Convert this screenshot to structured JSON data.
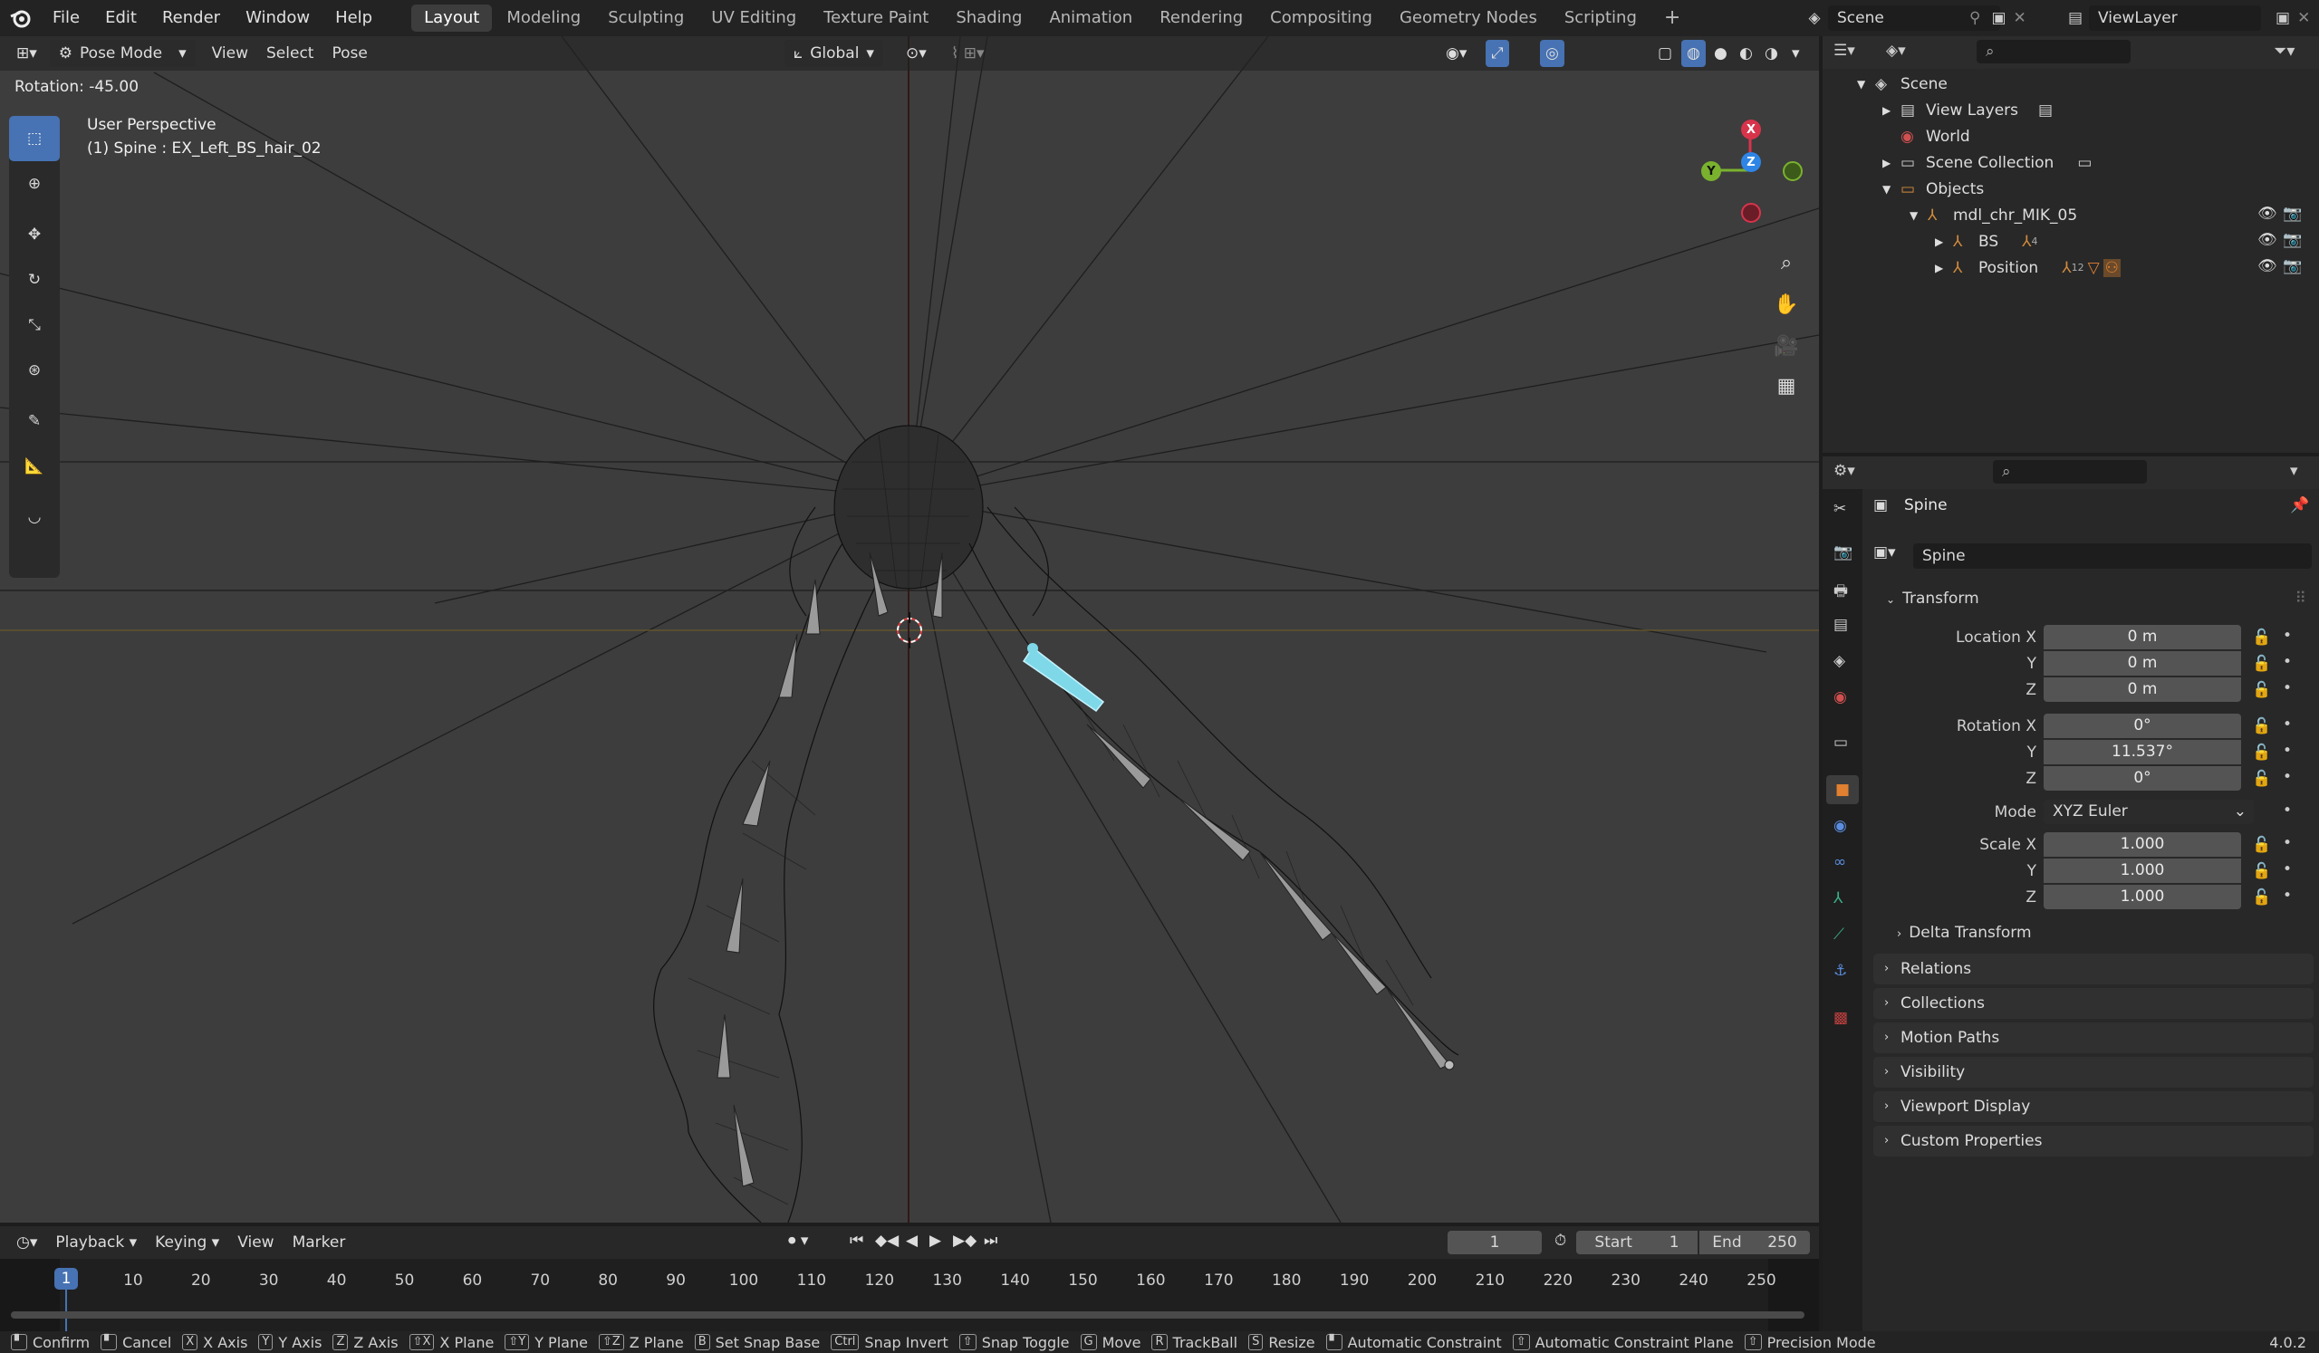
{
  "topbar": {
    "menus": [
      "File",
      "Edit",
      "Render",
      "Window",
      "Help"
    ],
    "workspaces": [
      "Layout",
      "Modeling",
      "Sculpting",
      "UV Editing",
      "Texture Paint",
      "Shading",
      "Animation",
      "Rendering",
      "Compositing",
      "Geometry Nodes",
      "Scripting"
    ],
    "active_workspace": "Layout",
    "add_tab": "+",
    "scene_label": "Scene",
    "viewlayer_label": "ViewLayer"
  },
  "viewport": {
    "mode_label": "Pose Mode",
    "menus": [
      "View",
      "Select",
      "Pose"
    ],
    "orientation": "Global",
    "operator_info": "Rotation: -45.00",
    "view_name": "User Perspective",
    "object_info": "(1) Spine : EX_Left_BS_hair_02",
    "gizmo": {
      "x": "X",
      "y": "Y",
      "z": "Z"
    }
  },
  "outliner": {
    "rows": [
      {
        "label": "Scene"
      },
      {
        "label": "View Layers"
      },
      {
        "label": "World"
      },
      {
        "label": "Scene Collection"
      },
      {
        "label": "Objects"
      },
      {
        "label": "mdl_chr_MIK_05"
      },
      {
        "label": "BS"
      },
      {
        "label": "Position"
      }
    ],
    "bs_count": "4",
    "position_count": "12"
  },
  "properties": {
    "header_name": "Spine",
    "object_name": "Spine",
    "transform_title": "Transform",
    "location_label": "Location X",
    "location": [
      "0 m",
      "0 m",
      "0 m"
    ],
    "rotation_label": "Rotation X",
    "rotation": [
      "0°",
      "11.537°",
      "0°"
    ],
    "mode_label": "Mode",
    "mode_value": "XYZ Euler",
    "scale_label": "Scale X",
    "scale": [
      "1.000",
      "1.000",
      "1.000"
    ],
    "axis_y": "Y",
    "axis_z": "Z",
    "delta": "Delta Transform",
    "panels": [
      "Relations",
      "Collections",
      "Motion Paths",
      "Visibility",
      "Viewport Display",
      "Custom Properties"
    ]
  },
  "timeline": {
    "menus": [
      "Playback",
      "Keying",
      "View",
      "Marker"
    ],
    "current_frame": "1",
    "start_label": "Start",
    "start_value": "1",
    "end_label": "End",
    "end_value": "250",
    "ticks": [
      "10",
      "20",
      "30",
      "40",
      "50",
      "60",
      "70",
      "80",
      "90",
      "100",
      "110",
      "120",
      "130",
      "140",
      "150",
      "160",
      "170",
      "180",
      "190",
      "200",
      "210",
      "220",
      "230",
      "240",
      "250"
    ],
    "playhead": "1"
  },
  "statusbar": {
    "items": [
      {
        "key": "",
        "label": "Confirm"
      },
      {
        "key": "",
        "label": "Cancel"
      },
      {
        "key": "X",
        "label": "X Axis"
      },
      {
        "key": "Y",
        "label": "Y Axis"
      },
      {
        "key": "Z",
        "label": "Z Axis"
      },
      {
        "key": "⇧X",
        "label": "X Plane"
      },
      {
        "key": "⇧Y",
        "label": "Y Plane"
      },
      {
        "key": "⇧Z",
        "label": "Z Plane"
      },
      {
        "key": "B",
        "label": "Set Snap Base"
      },
      {
        "key": "Ctrl",
        "label": "Snap Invert"
      },
      {
        "key": "⇧",
        "label": "Snap Toggle"
      },
      {
        "key": "G",
        "label": "Move"
      },
      {
        "key": "R",
        "label": "TrackBall"
      },
      {
        "key": "S",
        "label": "Resize"
      },
      {
        "key": "",
        "label": "Automatic Constraint"
      },
      {
        "key": "⇧",
        "label": "Automatic Constraint Plane"
      },
      {
        "key": "⇧",
        "label": "Precision Mode"
      }
    ],
    "version": "4.0.2"
  },
  "colors": {
    "accent": "#4772b3",
    "selected_bone": "#7fd8e8",
    "x_axis": "#d7344b",
    "y_axis": "#7ab22e",
    "z_axis": "#2f85e5"
  }
}
